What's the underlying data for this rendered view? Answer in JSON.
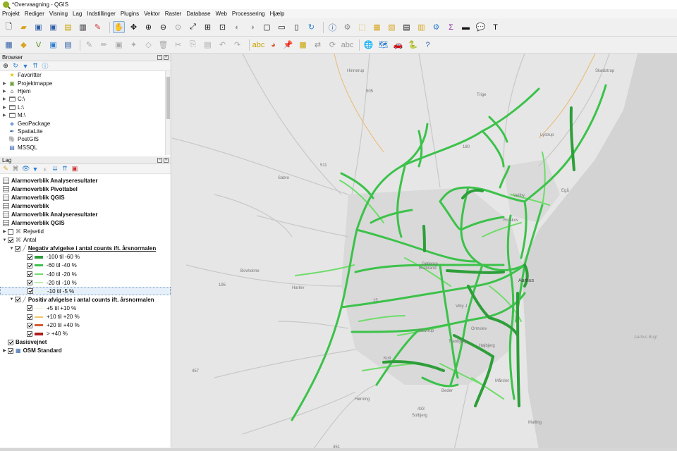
{
  "window": {
    "title": "*Overvaagning - QGIS"
  },
  "menu": [
    "Projekt",
    "Rediger",
    "Visning",
    "Lag",
    "Indstillinger",
    "Plugins",
    "Vektor",
    "Raster",
    "Database",
    "Web",
    "Processering",
    "Hjælp"
  ],
  "browser": {
    "title": "Browser",
    "items": [
      {
        "label": "Favoritter",
        "icon": "star-icon"
      },
      {
        "label": "Projektmappe",
        "icon": "project-folder-icon"
      },
      {
        "label": "Hjem",
        "icon": "home-folder-icon"
      },
      {
        "label": "C:\\",
        "icon": "folder-icon"
      },
      {
        "label": "L:\\",
        "icon": "folder-icon"
      },
      {
        "label": "M:\\",
        "icon": "folder-icon"
      },
      {
        "label": "GeoPackage",
        "icon": "geopackage-icon"
      },
      {
        "label": "SpatiaLite",
        "icon": "spatialite-icon"
      },
      {
        "label": "PostGIS",
        "icon": "postgis-icon"
      },
      {
        "label": "MSSQL",
        "icon": "mssql-icon"
      }
    ]
  },
  "layers": {
    "title": "Lag",
    "tables": [
      "Alarmoverblik Analyseresultater",
      "Alarmoverblik Pivottabel",
      "Alarmoverblik QGIS",
      "Alarmoverblik",
      "Alarmoverblik Analyseresultater",
      "Alarmoverblik QGIS"
    ],
    "rejsetid": "Rejsetid",
    "antal": "Antal",
    "negative_group": "Negativ afvigelse i antal counts ift. årsnormalen",
    "negative_classes": [
      {
        "label": "-100 til -60 %",
        "color": "#2e9e3a"
      },
      {
        "label": "-60 til -40 %",
        "color": "#3cc24a"
      },
      {
        "label": "-40 til -20 %",
        "color": "#6fdc6a"
      },
      {
        "label": "-20 til -10 %",
        "color": "#b7eeae"
      },
      {
        "label": "-10 til -5 %",
        "color": "#e3f7dc"
      }
    ],
    "positive_group": "Positiv afvigelse i antal counts ift. årsnormalen",
    "positive_classes": [
      {
        "label": "+5 til +10 %",
        "color": "#f7f2d2"
      },
      {
        "label": "+10 til +20 %",
        "color": "#f2c466"
      },
      {
        "label": "+20 til +40 %",
        "color": "#d85a35"
      },
      {
        "label": "> +40 %",
        "color": "#b01c1c"
      }
    ],
    "basisvejnet": "Basisvejnet",
    "osm": "OSM Standard"
  },
  "map": {
    "labels": [
      {
        "text": "Hinnerup"
      },
      {
        "text": "Skødstrup"
      },
      {
        "text": "Veilby"
      },
      {
        "text": "Risskov"
      },
      {
        "text": "Egå"
      },
      {
        "text": "Trige"
      },
      {
        "text": "Lystrup"
      },
      {
        "text": "Sabro"
      },
      {
        "text": "Skivholme"
      },
      {
        "text": "Harlev"
      },
      {
        "text": "Gellerup"
      },
      {
        "text": "Brabrand"
      },
      {
        "text": "Stavtrup"
      },
      {
        "text": "Aarhus"
      },
      {
        "text": "Aarhus Bugt"
      },
      {
        "text": "Højbjerg"
      },
      {
        "text": "Tranbjerg"
      },
      {
        "text": "Mårslet"
      },
      {
        "text": "Beder"
      },
      {
        "text": "Hørning"
      },
      {
        "text": "Malling"
      },
      {
        "text": "Solbjerg"
      },
      {
        "text": "Kolt"
      },
      {
        "text": "Ormslev"
      },
      {
        "text": "Viby J"
      }
    ],
    "road_numbers": [
      "505",
      "180",
      "511",
      "195",
      "15",
      "457",
      "433",
      "451"
    ],
    "colors": {
      "dark": "#2e9e3a",
      "mid": "#3cc24a",
      "light": "#6fdc6a",
      "background": "#e6e6e6",
      "sea": "#d3d3d3"
    }
  }
}
